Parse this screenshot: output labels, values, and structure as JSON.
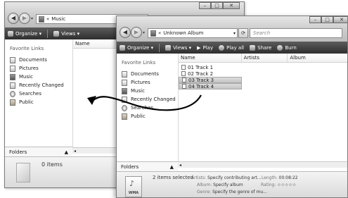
{
  "back_window": {
    "breadcrumb_prefix": "«",
    "address": "Music",
    "toolbar": {
      "organize": "Organize ▾",
      "views": "Views ▾"
    },
    "nav_title": "Favorite Links",
    "nav_items": [
      "Documents",
      "Pictures",
      "Music",
      "Recently Changed",
      "Searches",
      "Public"
    ],
    "column_name": "Name",
    "folders_label": "Folders",
    "empty_text": "0 items"
  },
  "front_window": {
    "breadcrumb_prefix": "«",
    "address": "Unknown Album",
    "search_placeholder": "Search",
    "toolbar": {
      "organize": "Organize ▾",
      "views": "Views ▾",
      "play": "Play",
      "play_all": "Play all",
      "share": "Share",
      "burn": "Burn"
    },
    "nav_title": "Favorite Links",
    "nav_items": [
      "Documents",
      "Pictures",
      "Music",
      "Recently Changed",
      "Searches",
      "Public"
    ],
    "columns": [
      "Name",
      "Artists",
      "Album"
    ],
    "tracks": [
      {
        "name": "01 Track 1",
        "selected": false
      },
      {
        "name": "02 Track 2",
        "selected": false
      },
      {
        "name": "03 Track 3",
        "selected": true
      },
      {
        "name": "04 Track 4",
        "selected": true
      }
    ],
    "folders_label": "Folders",
    "details": {
      "selected_count": "2 items selected",
      "artists_label": "Artists:",
      "artists_value": "Specify contributing art...",
      "length_label": "Length:",
      "length_value": "00:08:22",
      "album_label": "Album:",
      "album_value": "Specify album",
      "rating_label": "Rating:",
      "rating_value": "☆☆☆☆☆",
      "genre_label": "Genre:",
      "genre_value": "Specify the genre of mu...",
      "file_type": "WMA"
    }
  },
  "colors": {
    "toolbar": "#3f3f3f",
    "selection": "#cfcfcf"
  }
}
